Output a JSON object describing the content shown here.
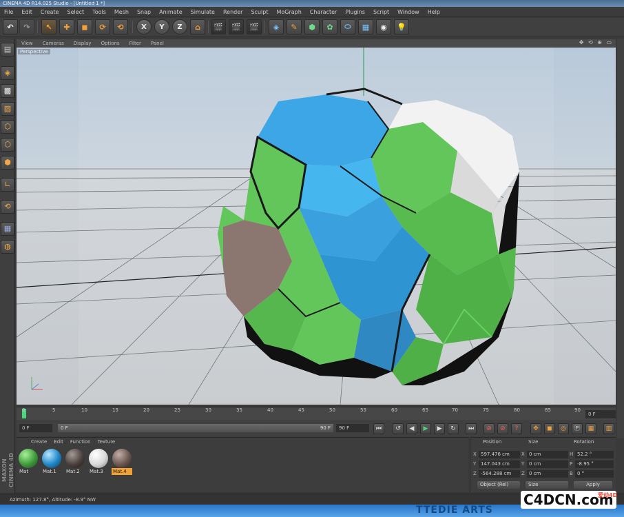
{
  "window": {
    "title": "CINEMA 4D R14.025 Studio - [Untitled 1 *]"
  },
  "menu": [
    "File",
    "Edit",
    "Create",
    "Select",
    "Tools",
    "Mesh",
    "Snap",
    "Animate",
    "Simulate",
    "Render",
    "Sculpt",
    "MoGraph",
    "Character",
    "Plugins",
    "Script",
    "Window",
    "Help"
  ],
  "toolbar": {
    "undo_icon": "undo-icon",
    "redo_icon": "redo-icon",
    "axis_x": "X",
    "axis_y": "Y",
    "axis_z": "Z"
  },
  "viewport": {
    "menu": [
      "View",
      "Cameras",
      "Display",
      "Options",
      "Filter",
      "Panel"
    ],
    "label": "Perspective",
    "corner_icons": "✥ ⟲ ⊕ ▭"
  },
  "timeline": {
    "ticks": [
      "0",
      "5",
      "10",
      "15",
      "20",
      "25",
      "30",
      "35",
      "40",
      "45",
      "50",
      "55",
      "60",
      "65",
      "70",
      "75",
      "80",
      "85",
      "90"
    ],
    "current_frame": "0 F"
  },
  "transport": {
    "start_field": "0 F",
    "range_start": "0 F",
    "range_end": "90 F",
    "end_field": "90 F"
  },
  "material_panel": {
    "menu": [
      "Create",
      "Edit",
      "Function",
      "Texture"
    ],
    "materials": [
      {
        "name": "Mat",
        "color": "#3e9a3a",
        "selected": false
      },
      {
        "name": "Mat.1",
        "color": "#1f86c8",
        "selected": false
      },
      {
        "name": "Mat.2",
        "color": "#4a403c",
        "selected": false
      },
      {
        "name": "Mat.3",
        "color": "#d9d9d9",
        "selected": false
      },
      {
        "name": "Mat.4",
        "color": "#6a5650",
        "selected": true
      }
    ]
  },
  "coordinates": {
    "headers": {
      "position": "Position",
      "size": "Size",
      "rotation": "Rotation"
    },
    "rows": [
      {
        "axis": "X",
        "position": "597.476 cm",
        "size_axis": "X",
        "size": "0 cm",
        "rot_axis": "H",
        "rotation": "52.2 °"
      },
      {
        "axis": "Y",
        "position": "147.043 cm",
        "size_axis": "Y",
        "size": "0 cm",
        "rot_axis": "P",
        "rotation": "-8.95 °"
      },
      {
        "axis": "Z",
        "position": "-564.288 cm",
        "size_axis": "Z",
        "size": "0 cm",
        "rot_axis": "B",
        "rotation": "0 °"
      }
    ],
    "mode_dropdown": "Object (Rel)",
    "size_dropdown": "Size",
    "apply_label": "Apply"
  },
  "statusbar": {
    "text": "Azimuth: 127.8°, Altitude: -8.9°  NW"
  },
  "branding": {
    "maxon": "MAXON CINEMA 4D",
    "logo": "C4DCN.com",
    "logo_sub": "爱动4D",
    "taskbar_brand": "TTEDIE ARTS"
  },
  "colors": {
    "green": "#63c65a",
    "blue": "#3da6e6",
    "white": "#eeeeee",
    "brown": "#8b7770",
    "accent": "#f0a035"
  }
}
